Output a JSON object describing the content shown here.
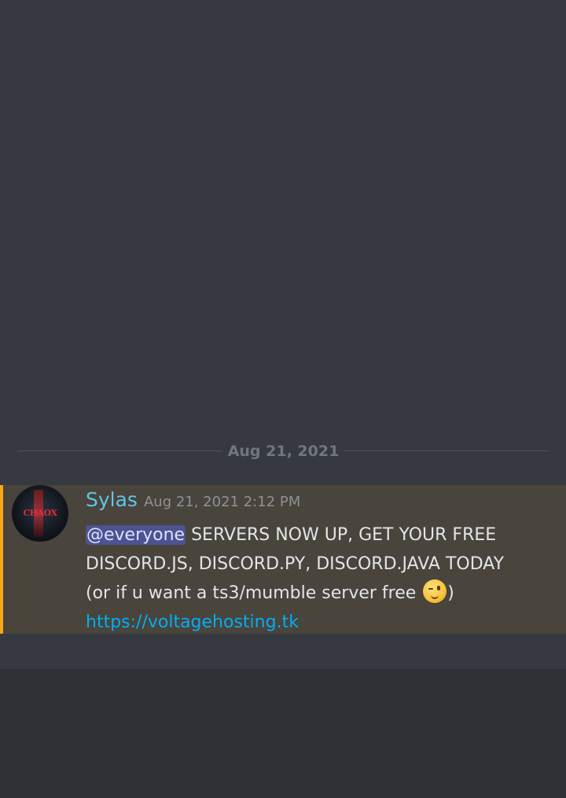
{
  "date_divider": {
    "label": "Aug 21, 2021"
  },
  "message": {
    "author": "Sylas",
    "timestamp": "Aug 21, 2021 2:12 PM",
    "avatar_text": "CHAOX",
    "mention": "@everyone",
    "line1_rest": " SERVERS NOW UP, GET YOUR FREE",
    "line2": "DISCORD.JS, DISCORD.PY, DISCORD.JAVA TODAY",
    "line3_before_emoji": "(or if u want a ts3/mumble server free ",
    "line3_after_emoji": ")",
    "emoji": "winking-face-emoji",
    "link": "https://voltagehosting.tk"
  },
  "colors": {
    "background": "#36393f",
    "mention_highlight": "#49443c",
    "mention_bar": "#faa61a",
    "username": "#5fc6e8",
    "link": "#00aff4"
  }
}
